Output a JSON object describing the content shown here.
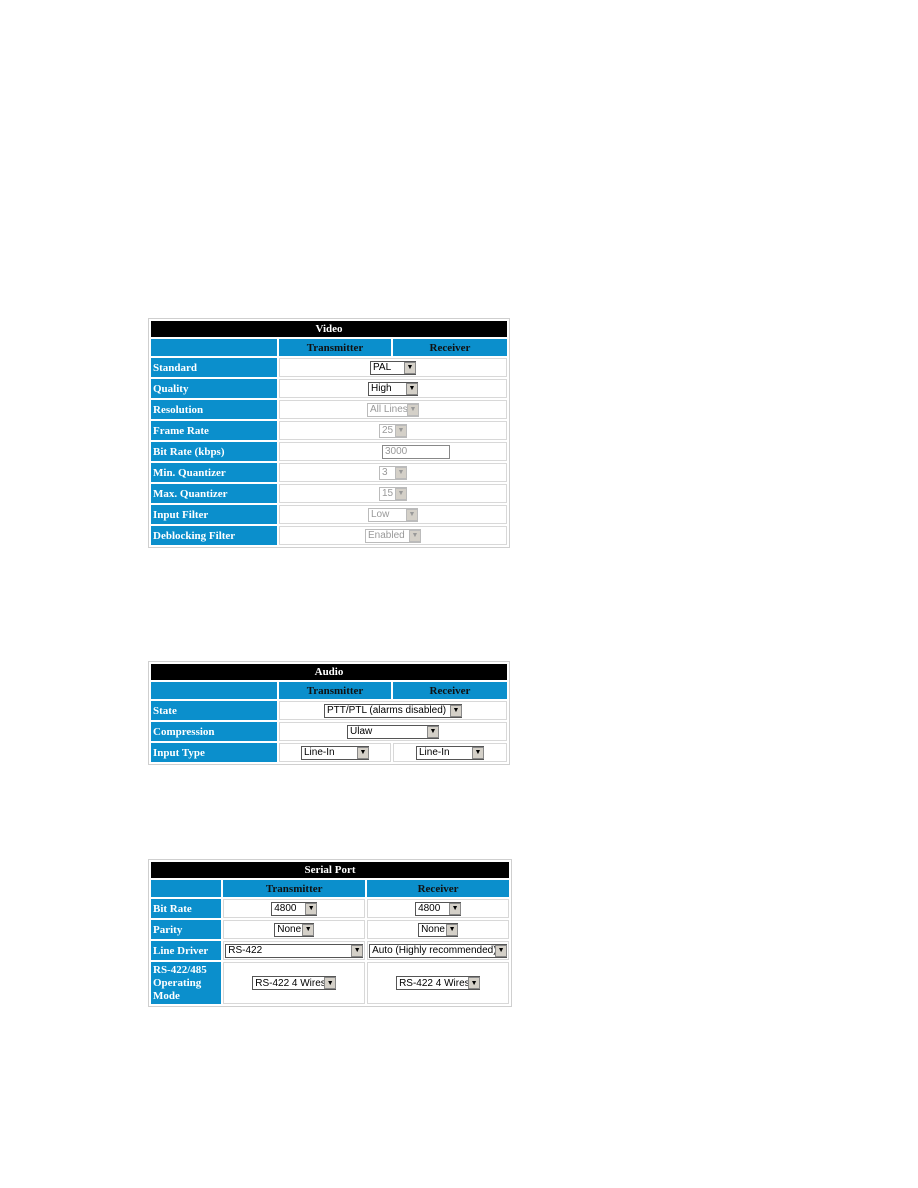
{
  "video": {
    "title": "Video",
    "col_transmitter": "Transmitter",
    "col_receiver": "Receiver",
    "rows": [
      {
        "label": "Standard",
        "value": "PAL",
        "enabled": true
      },
      {
        "label": "Quality",
        "value": "High",
        "enabled": true
      },
      {
        "label": "Resolution",
        "value": "All Lines",
        "enabled": false
      },
      {
        "label": "Frame Rate",
        "value": "25",
        "enabled": false
      },
      {
        "label": "Bit Rate (kbps)",
        "value": "3000",
        "enabled": false
      },
      {
        "label": "Min. Quantizer",
        "value": "3",
        "enabled": false
      },
      {
        "label": "Max. Quantizer",
        "value": "15",
        "enabled": false
      },
      {
        "label": "Input Filter",
        "value": "Low",
        "enabled": false
      },
      {
        "label": "Deblocking Filter",
        "value": "Enabled",
        "enabled": false
      }
    ]
  },
  "audio": {
    "title": "Audio",
    "col_transmitter": "Transmitter",
    "col_receiver": "Receiver",
    "rows": [
      {
        "label": "State",
        "value": "PTT/PTL (alarms disabled)"
      },
      {
        "label": "Compression",
        "value": "Ulaw"
      },
      {
        "label": "Input Type",
        "transmitter": "Line-In",
        "receiver": "Line-In"
      }
    ]
  },
  "serial": {
    "title": "Serial Port",
    "col_transmitter": "Transmitter",
    "col_receiver": "Receiver",
    "rows": [
      {
        "label": "Bit Rate",
        "transmitter": "4800",
        "receiver": "4800"
      },
      {
        "label": "Parity",
        "transmitter": "None",
        "receiver": "None"
      },
      {
        "label": "Line Driver",
        "transmitter": "RS-422",
        "receiver": "Auto (Highly recommended)"
      },
      {
        "label": "RS-422/485 Operating Mode",
        "transmitter": "RS-422 4 Wires",
        "receiver": "RS-422 4 Wires"
      }
    ]
  }
}
